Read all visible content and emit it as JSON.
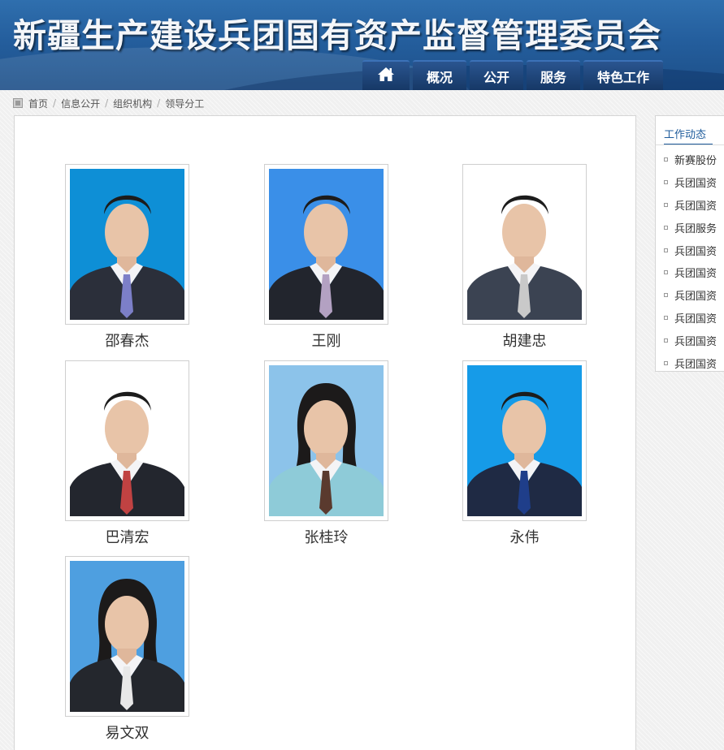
{
  "header": {
    "site_title": "新疆生产建设兵团国有资产监督管理委员会",
    "nav": [
      {
        "icon": "home-icon"
      },
      {
        "label": "概况"
      },
      {
        "label": "公开"
      },
      {
        "label": "服务"
      },
      {
        "label": "特色工作"
      }
    ]
  },
  "breadcrumb": {
    "icon": "breadcrumb-square-icon",
    "items": [
      "首页",
      "信息公开",
      "组织机构",
      "领导分工"
    ],
    "separator": "/"
  },
  "leaders": [
    {
      "name": "邵春杰",
      "bg": "#0e8fd6",
      "suit": "#2b2f3a",
      "tie": "#7c7fc8"
    },
    {
      "name": "王刚",
      "bg": "#3a8fe8",
      "suit": "#22252d",
      "tie": "#b3a1c2"
    },
    {
      "name": "胡建忠",
      "bg": "#ffffff",
      "suit": "#3b4352",
      "tie": "#c9c9c9"
    },
    {
      "name": "巴清宏",
      "bg": "#ffffff",
      "suit": "#23262e",
      "tie": "#c04242"
    },
    {
      "name": "张桂玲",
      "bg": "#8cc3ea",
      "suit": "#8ecbd8",
      "tie": "#5a3a2e"
    },
    {
      "name": "永伟",
      "bg": "#169be8",
      "suit": "#1f2a44",
      "tie": "#1f3e8a"
    },
    {
      "name": "易文双",
      "bg": "#4e9fe0",
      "suit": "#24272d",
      "tie": "#e8e8e8"
    }
  ],
  "sidebar": {
    "tab_label": "工作动态",
    "items": [
      "新赛股份",
      "兵团国资",
      "兵团国资",
      "兵团服务",
      "兵团国资",
      "兵团国资",
      "兵团国资",
      "兵团国资",
      "兵团国资",
      "兵团国资"
    ]
  }
}
